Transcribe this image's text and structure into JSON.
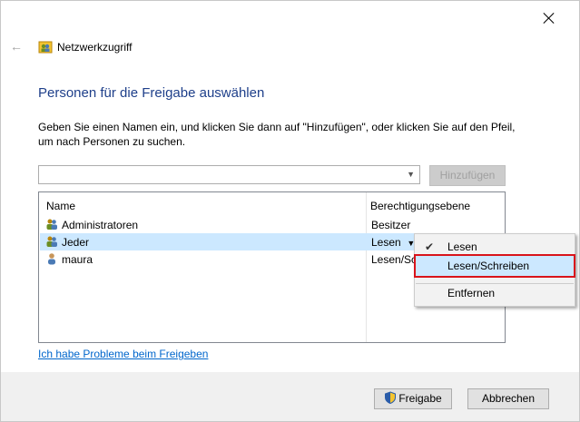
{
  "window": {
    "title": "Netzwerkzugriff"
  },
  "heading": "Personen für die Freigabe auswählen",
  "description": "Geben Sie einen Namen ein, und klicken Sie dann auf \"Hinzufügen\", oder klicken Sie auf den Pfeil, um nach Personen zu suchen.",
  "combo": {
    "value": ""
  },
  "buttons": {
    "add": "Hinzufügen",
    "share": "Freigabe",
    "cancel": "Abbrechen"
  },
  "list": {
    "columns": [
      "Name",
      "Berechtigungsebene"
    ],
    "rows": [
      {
        "name": "Administratoren",
        "perm": "Besitzer"
      },
      {
        "name": "Jeder",
        "perm": "Lesen"
      },
      {
        "name": "maura",
        "perm": "Lesen/Sc"
      }
    ]
  },
  "link": "Ich habe Probleme beim Freigeben",
  "menu": {
    "items": [
      "Lesen",
      "Lesen/Schreiben",
      "Entfernen"
    ]
  },
  "colors": {
    "heading": "#1e3f8a",
    "selection": "#cce8ff",
    "highlight": "#d9141b"
  }
}
